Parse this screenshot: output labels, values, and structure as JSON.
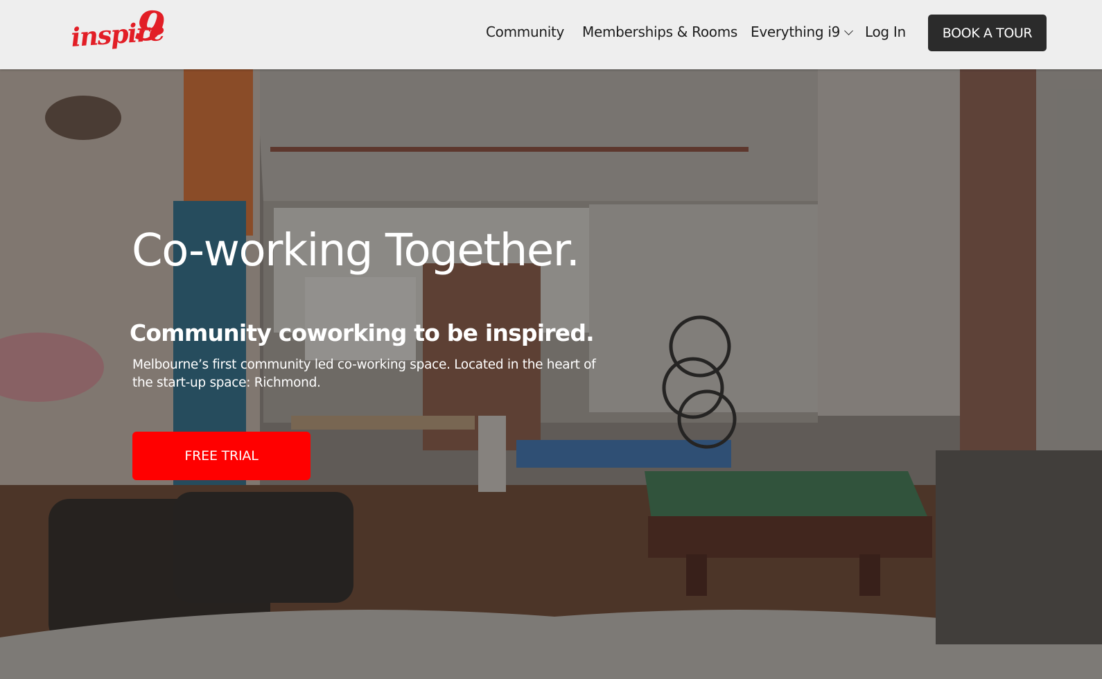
{
  "header": {
    "logo_text": "inspire9",
    "nav": [
      {
        "label": "Community"
      },
      {
        "label": "Memberships & Rooms"
      },
      {
        "label": "Everything i9",
        "icon": "chevron-down-icon"
      },
      {
        "label": "Log In"
      }
    ],
    "cta_label": "BOOK A TOUR"
  },
  "hero": {
    "title": "Co-working Together.",
    "subtitle": "Community coworking to be inspired.",
    "description": "Melbourne’s first community led co-working space. Located in the heart of the start-up space: Richmond.",
    "cta_label": "FREE TRIAL"
  },
  "colors": {
    "brand_red": "#e21e26",
    "cta_red": "#ff0000",
    "header_bg": "#eeeeee",
    "tour_button_bg": "#2b2b2b"
  }
}
